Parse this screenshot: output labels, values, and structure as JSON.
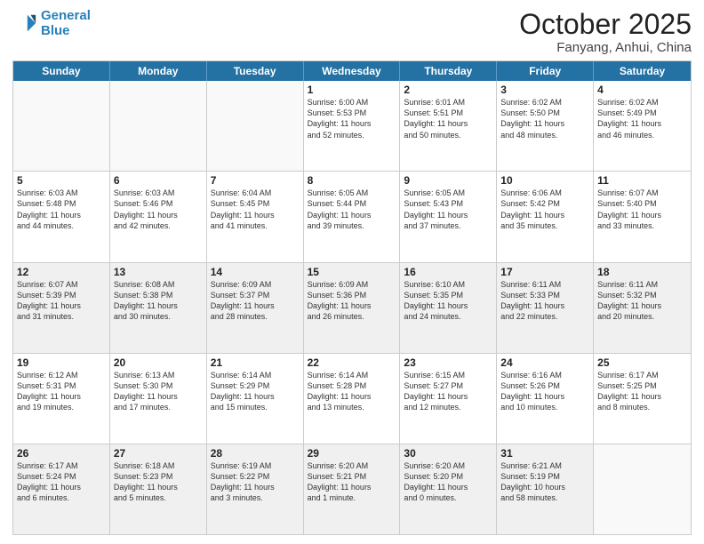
{
  "header": {
    "logo_line1": "General",
    "logo_line2": "Blue",
    "month": "October 2025",
    "location": "Fanyang, Anhui, China"
  },
  "weekdays": [
    "Sunday",
    "Monday",
    "Tuesday",
    "Wednesday",
    "Thursday",
    "Friday",
    "Saturday"
  ],
  "rows": [
    [
      {
        "day": "",
        "info": "",
        "empty": true
      },
      {
        "day": "",
        "info": "",
        "empty": true
      },
      {
        "day": "",
        "info": "",
        "empty": true
      },
      {
        "day": "1",
        "info": "Sunrise: 6:00 AM\nSunset: 5:53 PM\nDaylight: 11 hours\nand 52 minutes."
      },
      {
        "day": "2",
        "info": "Sunrise: 6:01 AM\nSunset: 5:51 PM\nDaylight: 11 hours\nand 50 minutes."
      },
      {
        "day": "3",
        "info": "Sunrise: 6:02 AM\nSunset: 5:50 PM\nDaylight: 11 hours\nand 48 minutes."
      },
      {
        "day": "4",
        "info": "Sunrise: 6:02 AM\nSunset: 5:49 PM\nDaylight: 11 hours\nand 46 minutes."
      }
    ],
    [
      {
        "day": "5",
        "info": "Sunrise: 6:03 AM\nSunset: 5:48 PM\nDaylight: 11 hours\nand 44 minutes."
      },
      {
        "day": "6",
        "info": "Sunrise: 6:03 AM\nSunset: 5:46 PM\nDaylight: 11 hours\nand 42 minutes."
      },
      {
        "day": "7",
        "info": "Sunrise: 6:04 AM\nSunset: 5:45 PM\nDaylight: 11 hours\nand 41 minutes."
      },
      {
        "day": "8",
        "info": "Sunrise: 6:05 AM\nSunset: 5:44 PM\nDaylight: 11 hours\nand 39 minutes."
      },
      {
        "day": "9",
        "info": "Sunrise: 6:05 AM\nSunset: 5:43 PM\nDaylight: 11 hours\nand 37 minutes."
      },
      {
        "day": "10",
        "info": "Sunrise: 6:06 AM\nSunset: 5:42 PM\nDaylight: 11 hours\nand 35 minutes."
      },
      {
        "day": "11",
        "info": "Sunrise: 6:07 AM\nSunset: 5:40 PM\nDaylight: 11 hours\nand 33 minutes."
      }
    ],
    [
      {
        "day": "12",
        "info": "Sunrise: 6:07 AM\nSunset: 5:39 PM\nDaylight: 11 hours\nand 31 minutes.",
        "shaded": true
      },
      {
        "day": "13",
        "info": "Sunrise: 6:08 AM\nSunset: 5:38 PM\nDaylight: 11 hours\nand 30 minutes.",
        "shaded": true
      },
      {
        "day": "14",
        "info": "Sunrise: 6:09 AM\nSunset: 5:37 PM\nDaylight: 11 hours\nand 28 minutes.",
        "shaded": true
      },
      {
        "day": "15",
        "info": "Sunrise: 6:09 AM\nSunset: 5:36 PM\nDaylight: 11 hours\nand 26 minutes.",
        "shaded": true
      },
      {
        "day": "16",
        "info": "Sunrise: 6:10 AM\nSunset: 5:35 PM\nDaylight: 11 hours\nand 24 minutes.",
        "shaded": true
      },
      {
        "day": "17",
        "info": "Sunrise: 6:11 AM\nSunset: 5:33 PM\nDaylight: 11 hours\nand 22 minutes.",
        "shaded": true
      },
      {
        "day": "18",
        "info": "Sunrise: 6:11 AM\nSunset: 5:32 PM\nDaylight: 11 hours\nand 20 minutes.",
        "shaded": true
      }
    ],
    [
      {
        "day": "19",
        "info": "Sunrise: 6:12 AM\nSunset: 5:31 PM\nDaylight: 11 hours\nand 19 minutes."
      },
      {
        "day": "20",
        "info": "Sunrise: 6:13 AM\nSunset: 5:30 PM\nDaylight: 11 hours\nand 17 minutes."
      },
      {
        "day": "21",
        "info": "Sunrise: 6:14 AM\nSunset: 5:29 PM\nDaylight: 11 hours\nand 15 minutes."
      },
      {
        "day": "22",
        "info": "Sunrise: 6:14 AM\nSunset: 5:28 PM\nDaylight: 11 hours\nand 13 minutes."
      },
      {
        "day": "23",
        "info": "Sunrise: 6:15 AM\nSunset: 5:27 PM\nDaylight: 11 hours\nand 12 minutes."
      },
      {
        "day": "24",
        "info": "Sunrise: 6:16 AM\nSunset: 5:26 PM\nDaylight: 11 hours\nand 10 minutes."
      },
      {
        "day": "25",
        "info": "Sunrise: 6:17 AM\nSunset: 5:25 PM\nDaylight: 11 hours\nand 8 minutes."
      }
    ],
    [
      {
        "day": "26",
        "info": "Sunrise: 6:17 AM\nSunset: 5:24 PM\nDaylight: 11 hours\nand 6 minutes.",
        "shaded": true
      },
      {
        "day": "27",
        "info": "Sunrise: 6:18 AM\nSunset: 5:23 PM\nDaylight: 11 hours\nand 5 minutes.",
        "shaded": true
      },
      {
        "day": "28",
        "info": "Sunrise: 6:19 AM\nSunset: 5:22 PM\nDaylight: 11 hours\nand 3 minutes.",
        "shaded": true
      },
      {
        "day": "29",
        "info": "Sunrise: 6:20 AM\nSunset: 5:21 PM\nDaylight: 11 hours\nand 1 minute.",
        "shaded": true
      },
      {
        "day": "30",
        "info": "Sunrise: 6:20 AM\nSunset: 5:20 PM\nDaylight: 11 hours\nand 0 minutes.",
        "shaded": true
      },
      {
        "day": "31",
        "info": "Sunrise: 6:21 AM\nSunset: 5:19 PM\nDaylight: 10 hours\nand 58 minutes.",
        "shaded": true
      },
      {
        "day": "",
        "info": "",
        "empty": true,
        "shaded": true
      }
    ]
  ]
}
